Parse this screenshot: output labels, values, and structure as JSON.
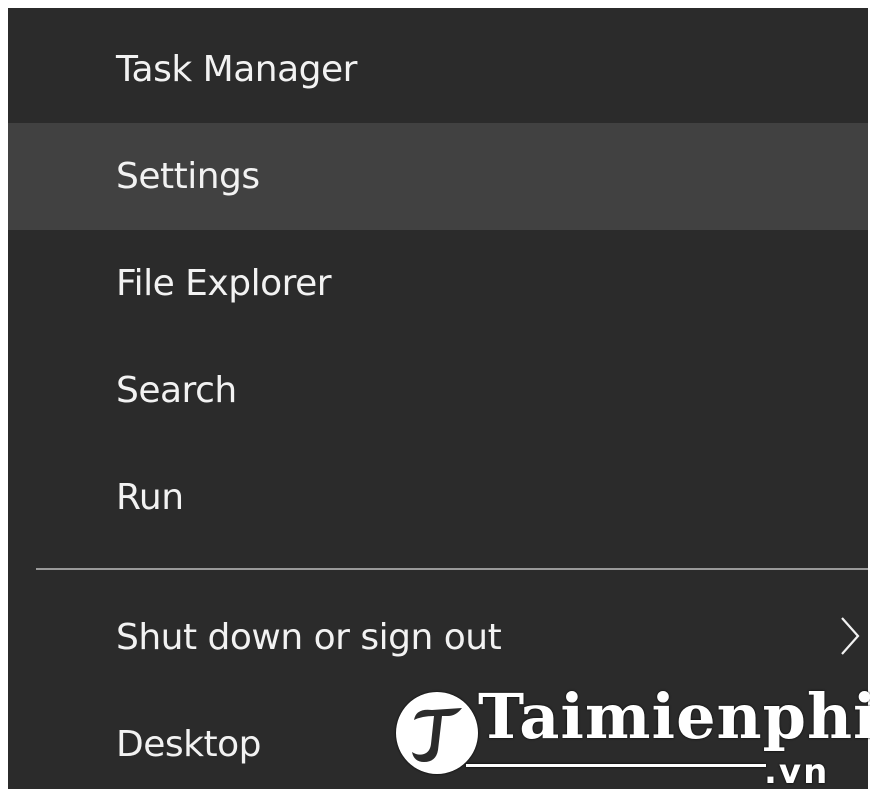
{
  "menu": {
    "items": [
      {
        "label": "Task Manager"
      },
      {
        "label": "Settings",
        "state": "hovered"
      },
      {
        "label": "File Explorer"
      },
      {
        "label": "Search"
      },
      {
        "label": "Run"
      },
      {
        "label": "Shut down or sign out",
        "submenu_icon": "chevron-right-icon"
      },
      {
        "label": "Desktop"
      }
    ]
  },
  "watermark": {
    "text": "Taimienphi",
    "suffix": ".vn"
  },
  "colors": {
    "menu_background": "#2b2b2b",
    "hover_background": "#414141",
    "text": "#f2f2f2",
    "separator": "#9a9a9a"
  }
}
